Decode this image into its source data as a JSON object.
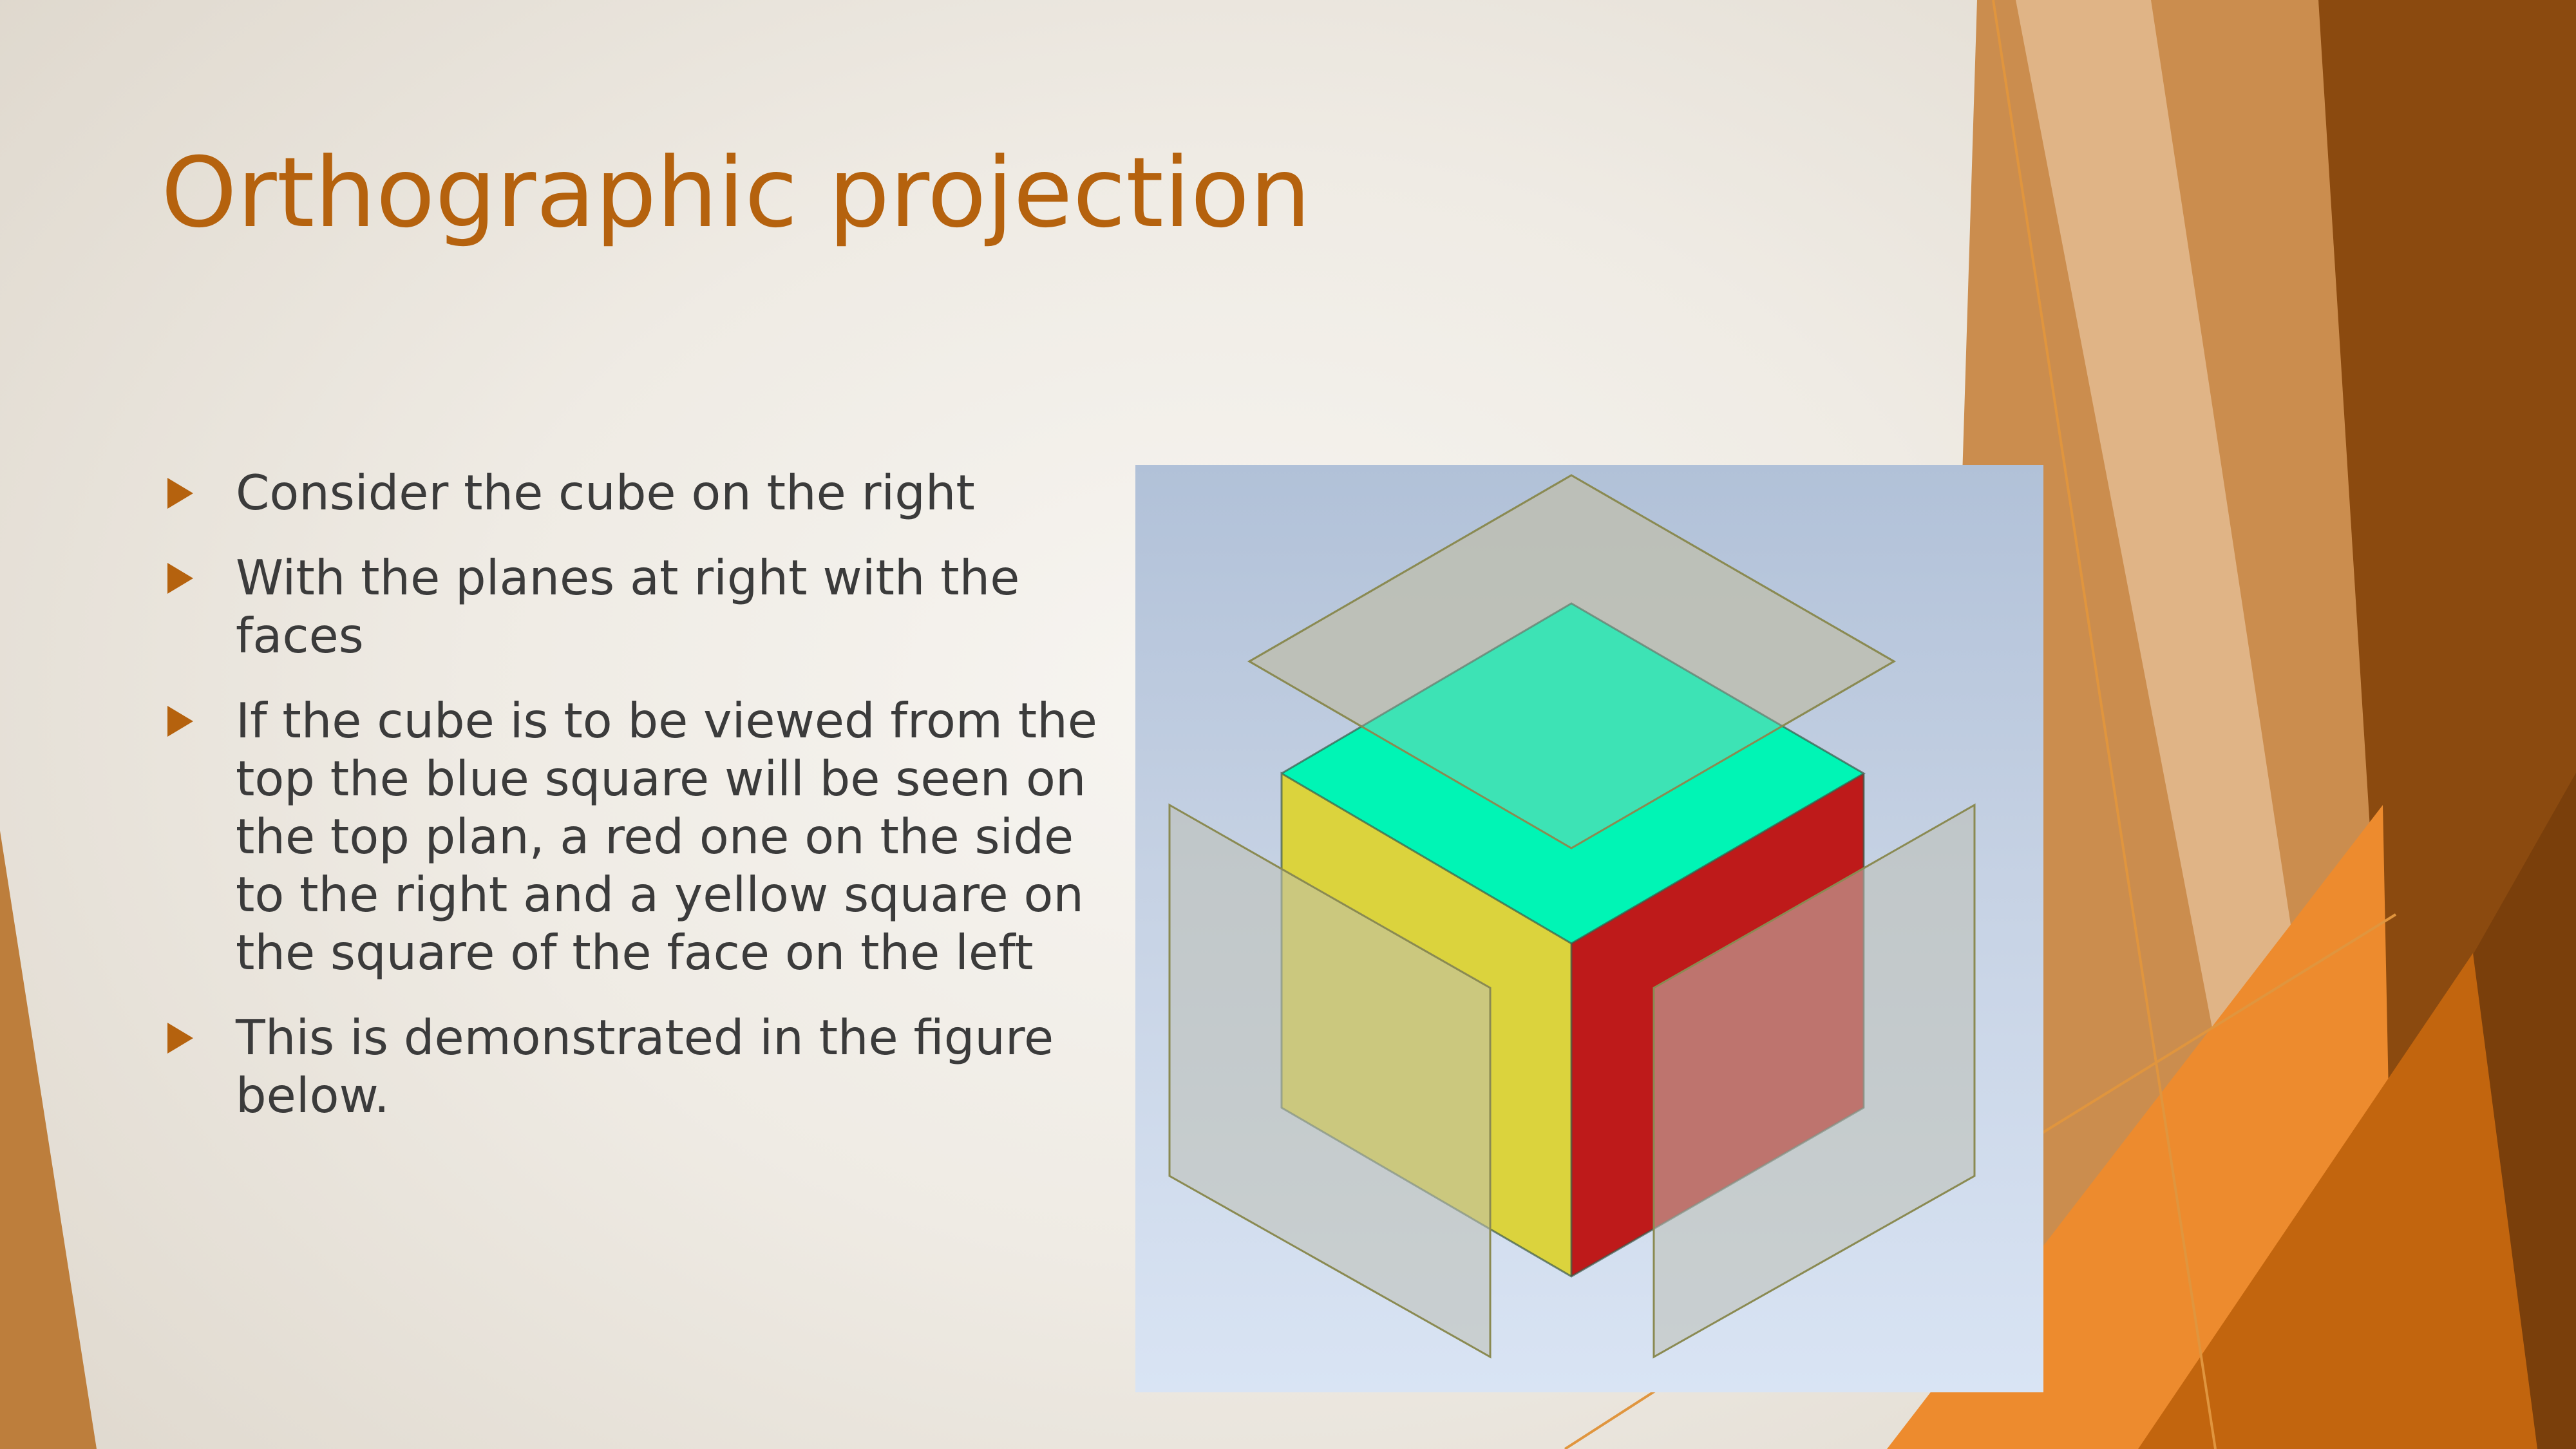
{
  "slide": {
    "title": "Orthographic projection",
    "bullets": [
      {
        "text": "Consider the cube on the right"
      },
      {
        "text": "With the planes at right with the faces"
      },
      {
        "text": "If the cube is to be viewed from the top the blue square will be seen on the top plan, a red one on the side to the right and a yellow square on the square of the face on the left"
      },
      {
        "text": "This is demonstrated in the figure below."
      }
    ],
    "accent_color": "#b5620e"
  },
  "figure": {
    "faces": {
      "top_color": "#00f5b5",
      "right_color": "#be1a1a",
      "left_color": "#dbd33d"
    },
    "plane_color": "#bdbfb4"
  }
}
